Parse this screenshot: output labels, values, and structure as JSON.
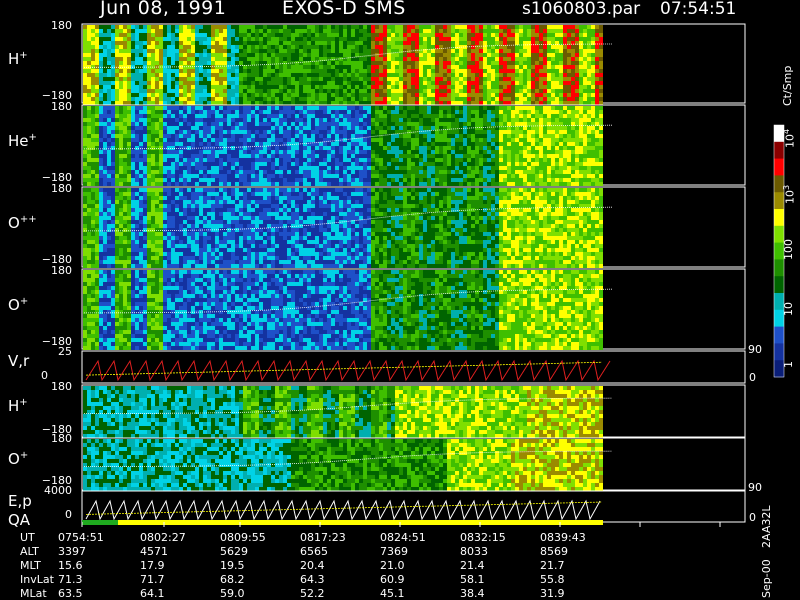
{
  "header": {
    "date": "Jun 08, 1991",
    "instrument": "EXOS-D SMS",
    "file": "s1060803.par",
    "time": "07:54:51"
  },
  "colorbar": {
    "unit": "Ct/Smp",
    "ticks": [
      "10^4",
      "10^3",
      "100",
      "10",
      "1"
    ],
    "colors": [
      "#ffffff",
      "#8b0000",
      "#ff0000",
      "#6b5a00",
      "#9a8a00",
      "#ffff00",
      "#7fdf00",
      "#3fbf00",
      "#1e8f00",
      "#006400",
      "#00afaf",
      "#00d2e6",
      "#1e50c8",
      "#1432a0",
      "#0a1e78"
    ]
  },
  "side_labels": {
    "top": "90",
    "bottom": "0"
  },
  "footer": {
    "side_date": "Sep-00",
    "side_code": "2AA32L"
  },
  "chart_data": [
    {
      "type": "heatmap",
      "ylabel": "H",
      "ysup": "+",
      "ylim": [
        -180,
        180
      ],
      "ticks": [
        "180",
        "−180"
      ]
    },
    {
      "type": "heatmap",
      "ylabel": "He",
      "ysup": "+",
      "ylim": [
        -180,
        180
      ],
      "ticks": [
        "180",
        "−180"
      ]
    },
    {
      "type": "heatmap",
      "ylabel": "O",
      "ysup": "++",
      "ylim": [
        -180,
        180
      ],
      "ticks": [
        "180",
        "−180"
      ]
    },
    {
      "type": "heatmap",
      "ylabel": "O",
      "ysup": "+",
      "ylim": [
        -180,
        180
      ],
      "ticks": [
        "180",
        "−180"
      ]
    },
    {
      "type": "line",
      "ylabel": "V,r",
      "ylim": [
        0,
        25
      ],
      "ticks": [
        "25",
        "0"
      ]
    },
    {
      "type": "heatmap",
      "ylabel": "H",
      "ysup": "+",
      "ylim": [
        -180,
        180
      ],
      "ticks": [
        "180",
        "−180"
      ]
    },
    {
      "type": "heatmap",
      "ylabel": "O",
      "ysup": "+",
      "ylim": [
        -180,
        180
      ],
      "ticks": [
        "180",
        "−180"
      ]
    },
    {
      "type": "line",
      "ylabel": "E,p",
      "ylim": [
        0,
        4000
      ],
      "ticks": [
        "4000",
        "0"
      ]
    }
  ],
  "qa": {
    "label": "QA"
  },
  "ephemeris": {
    "rows": [
      {
        "label": "UT",
        "values": [
          "0754:51",
          "0802:27",
          "0809:55",
          "0817:23",
          "0824:51",
          "0832:15",
          "0839:43"
        ]
      },
      {
        "label": "ALT",
        "values": [
          "3397",
          "4571",
          "5629",
          "6565",
          "7369",
          "8033",
          "8569"
        ]
      },
      {
        "label": "MLT",
        "values": [
          "15.6",
          "17.9",
          "19.5",
          "20.4",
          "21.0",
          "21.4",
          "21.7"
        ]
      },
      {
        "label": "InvLat",
        "values": [
          "71.3",
          "71.7",
          "68.2",
          "64.3",
          "60.9",
          "58.1",
          "55.8"
        ]
      },
      {
        "label": "MLat",
        "values": [
          "63.5",
          "64.1",
          "59.0",
          "52.2",
          "45.1",
          "38.4",
          "31.9"
        ]
      }
    ]
  }
}
